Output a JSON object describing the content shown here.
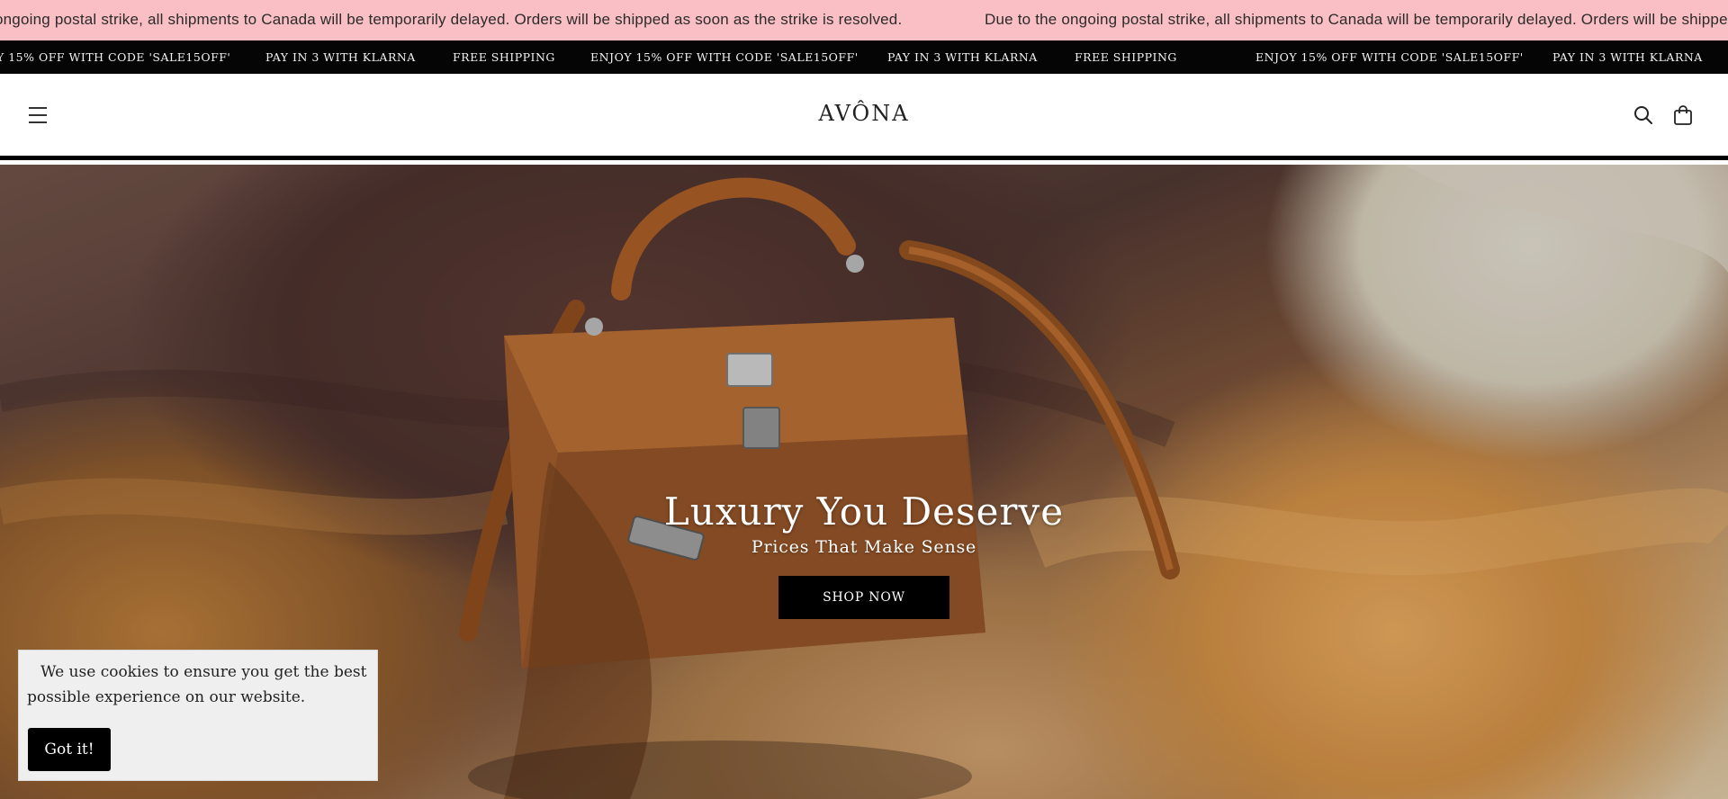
{
  "announcement": {
    "message_partial": "ongoing postal strike, all shipments to Canada will be temporarily delayed. Orders will be shipped as soon as the strike is resolved.",
    "message_repeat": "Due to the ongoing postal strike, all shipments to Canada will be temporarily delayed. Orders will be shipped as soon as the strike is resolved."
  },
  "ticker": {
    "items": [
      "Y 15% OFF WITH CODE 'SALE15OFF'",
      "PAY IN 3 WITH KLARNA",
      "FREE SHIPPING",
      "ENJOY 15% OFF WITH CODE 'SALE15OFF'",
      "PAY IN 3 WITH KLARNA",
      "FREE SHIPPING",
      "ENJOY 15% OFF WITH CODE 'SALE15OFF'",
      "PAY IN 3 WITH KLARNA"
    ]
  },
  "header": {
    "logo": "AVÔNA",
    "icons": [
      "menu-icon",
      "search-icon",
      "cart-icon"
    ]
  },
  "hero": {
    "title": "Luxury You Deserve",
    "subtitle": "Prices That Make Sense",
    "cta_label": "SHOP NOW"
  },
  "cookie": {
    "message": "We use cookies to ensure you get the best possible experience on our website.",
    "accept_label": "Got it!"
  },
  "colors": {
    "announcement_bg": "#f9bfc4",
    "ticker_bg": "#050505",
    "button_bg": "#000000",
    "cookie_bg": "#efefef"
  }
}
